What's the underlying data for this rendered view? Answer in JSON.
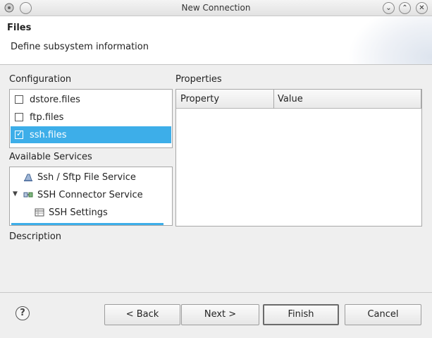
{
  "window": {
    "title": "New Connection"
  },
  "header": {
    "title": "Files",
    "description": "Define subsystem information"
  },
  "configuration": {
    "label": "Configuration",
    "items": [
      {
        "label": "dstore.files",
        "checked": false,
        "selected": false
      },
      {
        "label": "ftp.files",
        "checked": false,
        "selected": false
      },
      {
        "label": "ssh.files",
        "checked": true,
        "selected": true
      }
    ]
  },
  "services": {
    "label": "Available Services",
    "items": [
      {
        "label": "Ssh / Sftp File Service",
        "icon": "file-service-icon"
      },
      {
        "label": "SSH Connector Service",
        "icon": "connector-icon",
        "expanded": true
      },
      {
        "label": "SSH Settings",
        "icon": "settings-table-icon"
      }
    ]
  },
  "properties": {
    "label": "Properties",
    "columns": [
      "Property",
      "Value"
    ]
  },
  "description_label": "Description",
  "buttons": {
    "help": "?",
    "back": "< Back",
    "next": "Next >",
    "finish": "Finish",
    "cancel": "Cancel"
  },
  "colors": {
    "selection": "#3daee9",
    "background": "#efefef"
  }
}
